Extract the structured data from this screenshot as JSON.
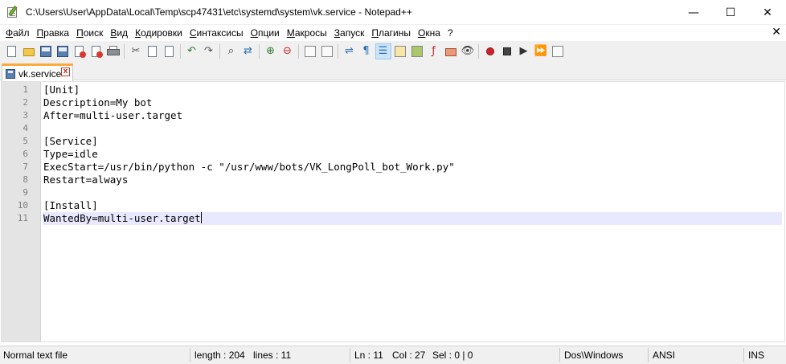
{
  "window": {
    "title": "C:\\Users\\User\\AppData\\Local\\Temp\\scp47431\\etc\\systemd\\system\\vk.service - Notepad++",
    "minimize": "—",
    "maximize": "☐",
    "close": "✕"
  },
  "menu": {
    "items": [
      "Файл",
      "Правка",
      "Поиск",
      "Вид",
      "Кодировки",
      "Синтаксисы",
      "Опции",
      "Макросы",
      "Запуск",
      "Плагины",
      "Окна",
      "?"
    ],
    "close": "✕"
  },
  "tab": {
    "label": "vk.service",
    "close": "x"
  },
  "editor": {
    "lines": [
      {
        "num": "1",
        "text": "[Unit]"
      },
      {
        "num": "2",
        "text": "Description=My bot"
      },
      {
        "num": "3",
        "text": "After=multi-user.target"
      },
      {
        "num": "4",
        "text": ""
      },
      {
        "num": "5",
        "text": "[Service]"
      },
      {
        "num": "6",
        "text": "Type=idle"
      },
      {
        "num": "7",
        "text": "ExecStart=/usr/bin/python -c \"/usr/www/bots/VK_LongPoll_bot_Work.py\""
      },
      {
        "num": "8",
        "text": "Restart=always"
      },
      {
        "num": "9",
        "text": ""
      },
      {
        "num": "10",
        "text": "[Install]"
      },
      {
        "num": "11",
        "text": "WantedBy=multi-user.target"
      }
    ],
    "current_line": 11
  },
  "status": {
    "file_type": "Normal text file",
    "length": "length : 204",
    "lines": "lines : 11",
    "ln": "Ln : 11",
    "col": "Col : 27",
    "sel": "Sel : 0 | 0",
    "eol": "Dos\\Windows",
    "encoding": "ANSI",
    "mode": "INS"
  }
}
